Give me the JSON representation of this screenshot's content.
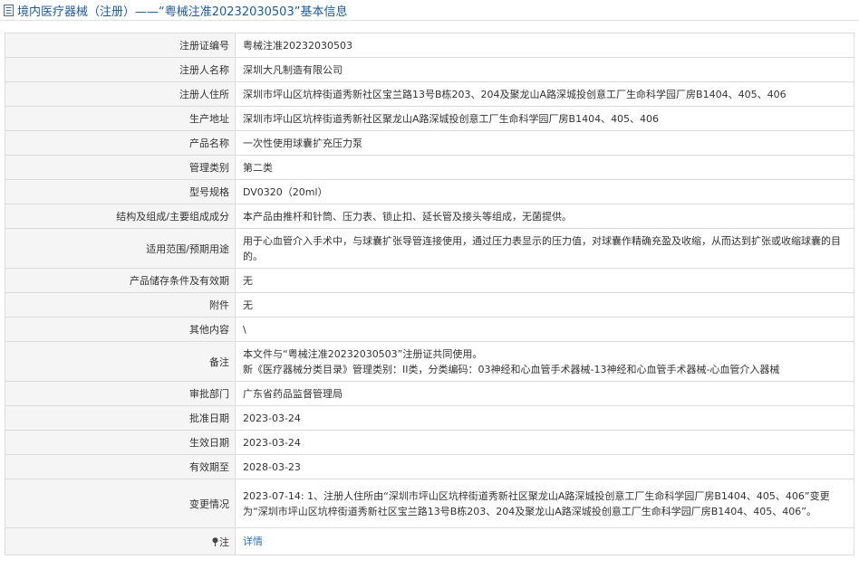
{
  "header": {
    "title": "境内医疗器械（注册）——“粤械注准20232030503”基本信息"
  },
  "rows": [
    {
      "label": "注册证编号",
      "value": "粤械注准20232030503"
    },
    {
      "label": "注册人名称",
      "value": "深圳大凡制造有限公司"
    },
    {
      "label": "注册人住所",
      "value": "深圳市坪山区坑梓街道秀新社区宝兰路13号B栋203、204及聚龙山A路深城投创意工厂生命科学园厂房B1404、405、406"
    },
    {
      "label": "生产地址",
      "value": "深圳市坪山区坑梓街道秀新社区聚龙山A路深城投创意工厂生命科学园厂房B1404、405、406"
    },
    {
      "label": "产品名称",
      "value": "一次性使用球囊扩充压力泵"
    },
    {
      "label": "管理类别",
      "value": "第二类"
    },
    {
      "label": "型号规格",
      "value": "DV0320（20ml）"
    },
    {
      "label": "结构及组成/主要组成成分",
      "value": "本产品由推杆和针筒、压力表、锁止扣、延长管及接头等组成，无菌提供。"
    },
    {
      "label": "适用范围/预期用途",
      "value": "用于心血管介入手术中，与球囊扩张导管连接使用，通过压力表显示的压力值，对球囊作精确充盈及收缩，从而达到扩张或收缩球囊的目的。"
    },
    {
      "label": "产品储存条件及有效期",
      "value": "无"
    },
    {
      "label": "附件",
      "value": "无"
    },
    {
      "label": "其他内容",
      "value": "\\"
    },
    {
      "label": "备注",
      "value_lines": [
        "本文件与“粤械注准20232030503”注册证共同使用。",
        "新《医疗器械分类目录》管理类别：II类，分类编码：03神经和心血管手术器械-13神经和心血管手术器械-心血管介入器械"
      ]
    },
    {
      "label": "审批部门",
      "value": "广东省药品监督管理局"
    },
    {
      "label": "批准日期",
      "value": "2023-03-24"
    },
    {
      "label": "生效日期",
      "value": "2023-03-24"
    },
    {
      "label": "有效期至",
      "value": "2028-03-23"
    },
    {
      "label": "变更情况",
      "value": "2023-07-14: 1、注册人住所由“深圳市坪山区坑梓街道秀新社区聚龙山A路深城投创意工厂生命科学园厂房B1404、405、406”变更为“深圳市坪山区坑梓街道秀新社区宝兰路13号B栋203、204及聚龙山A路深城投创意工厂生命科学园厂房B1404、405、406”。"
    },
    {
      "label": "注",
      "value": "详情"
    }
  ],
  "icons": {
    "title": "document-list-icon",
    "note": "pin-icon"
  },
  "colors": {
    "title": "#1f5a99",
    "link": "#2e72b8",
    "label_bg": "#f5f5f5",
    "border": "#dcdcdc"
  }
}
